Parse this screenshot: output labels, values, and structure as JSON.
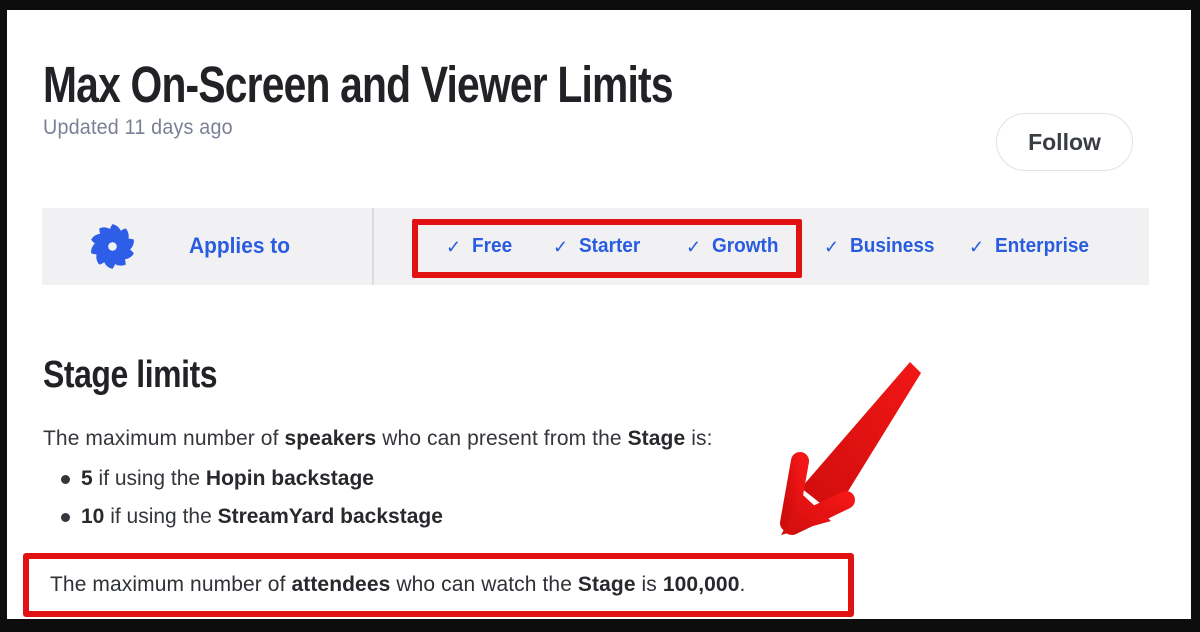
{
  "page": {
    "title": "Max On-Screen and Viewer Limits",
    "updated": "Updated 11 days ago"
  },
  "toolbar": {
    "follow_label": "Follow"
  },
  "applies_banner": {
    "label": "Applies to",
    "logo": "hopin-spiral-logo",
    "check_glyph": "✓",
    "tiers": [
      {
        "name": "Free",
        "checked": true,
        "highlighted": true
      },
      {
        "name": "Starter",
        "checked": true,
        "highlighted": true
      },
      {
        "name": "Growth",
        "checked": true,
        "highlighted": true
      },
      {
        "name": "Business",
        "checked": true,
        "highlighted": false
      },
      {
        "name": "Enterprise",
        "checked": true,
        "highlighted": false
      }
    ]
  },
  "article": {
    "section_heading": "Stage limits",
    "intro": [
      {
        "t": "The maximum number of "
      },
      {
        "t": "speakers",
        "b": true
      },
      {
        "t": " who can present from the "
      },
      {
        "t": "Stage",
        "b": true
      },
      {
        "t": " is:"
      }
    ],
    "bullets": [
      [
        {
          "t": "5",
          "b": true
        },
        {
          "t": " if using the "
        },
        {
          "t": "Hopin backstage",
          "b": true
        }
      ],
      [
        {
          "t": "10",
          "b": true
        },
        {
          "t": " if using the "
        },
        {
          "t": "StreamYard backstage",
          "b": true
        }
      ]
    ],
    "highlight": [
      {
        "t": "The maximum number of "
      },
      {
        "t": "attendees",
        "b": true
      },
      {
        "t": " who can watch the "
      },
      {
        "t": "Stage",
        "b": true
      },
      {
        "t": " is "
      },
      {
        "t": "100,000",
        "b": true
      },
      {
        "t": "."
      }
    ]
  },
  "colors": {
    "accent_blue": "#2a5ce0",
    "annotation_red": "#e01212",
    "banner_bg": "#f1f1f4"
  }
}
